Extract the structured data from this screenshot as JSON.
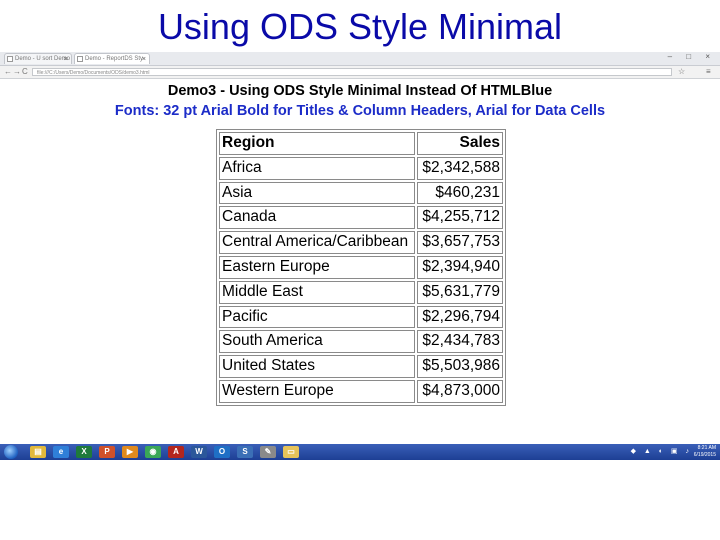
{
  "slide": {
    "title": "Using ODS Style Minimal"
  },
  "browser": {
    "tabs": [
      {
        "label": "Demo - U sort Demo",
        "close": "×"
      },
      {
        "label": "Demo - ReportDS Sty",
        "close": "×"
      }
    ],
    "window_controls": "– □ ×",
    "nav": {
      "back": "←",
      "forward": "→",
      "reload": "C"
    },
    "address": "file:///C:/Users/Demo/Documents/ODS/demo3.html",
    "address_right_icons": [
      "☆",
      "≡"
    ]
  },
  "report": {
    "title": "Demo3 - Using ODS Style Minimal Instead Of HTMLBlue",
    "subtitle": "Fonts: 32 pt Arial Bold for Titles & Column Headers, Arial for Data Cells",
    "columns": [
      "Region",
      "Sales"
    ],
    "rows": [
      {
        "region": "Africa",
        "sales": "$2,342,588"
      },
      {
        "region": "Asia",
        "sales": "$460,231"
      },
      {
        "region": "Canada",
        "sales": "$4,255,712"
      },
      {
        "region": "Central America/Caribbean",
        "sales": "$3,657,753"
      },
      {
        "region": "Eastern Europe",
        "sales": "$2,394,940"
      },
      {
        "region": "Middle East",
        "sales": "$5,631,779"
      },
      {
        "region": "Pacific",
        "sales": "$2,296,794"
      },
      {
        "region": "South America",
        "sales": "$2,434,783"
      },
      {
        "region": "United States",
        "sales": "$5,503,986"
      },
      {
        "region": "Western Europe",
        "sales": "$4,873,000"
      }
    ]
  },
  "taskbar": {
    "pinned": [
      {
        "name": "windows-explorer-icon",
        "glyph": "▤",
        "color": "#e2b93b"
      },
      {
        "name": "internet-explorer-icon",
        "glyph": "e",
        "color": "#2f7fd8"
      },
      {
        "name": "excel-icon",
        "glyph": "X",
        "color": "#1e7a3c"
      },
      {
        "name": "powerpoint-icon",
        "glyph": "P",
        "color": "#d0512a"
      },
      {
        "name": "media-player-icon",
        "glyph": "▶",
        "color": "#e08a1e"
      },
      {
        "name": "chrome-icon",
        "glyph": "◉",
        "color": "#3aa757"
      },
      {
        "name": "acrobat-icon",
        "glyph": "A",
        "color": "#b3261e"
      },
      {
        "name": "word-icon",
        "glyph": "W",
        "color": "#2b579a"
      },
      {
        "name": "outlook-icon",
        "glyph": "O",
        "color": "#1f6fc5"
      },
      {
        "name": "sas-icon",
        "glyph": "S",
        "color": "#3b6fb6"
      },
      {
        "name": "paint-icon",
        "glyph": "✎",
        "color": "#8a8a8a"
      },
      {
        "name": "folder-icon",
        "glyph": "▭",
        "color": "#e6c35a"
      }
    ],
    "tray_icons": "◆ ▲ ◐ ▣ ♪",
    "clock_time": "8:21 AM",
    "clock_date": "6/19/2015"
  }
}
